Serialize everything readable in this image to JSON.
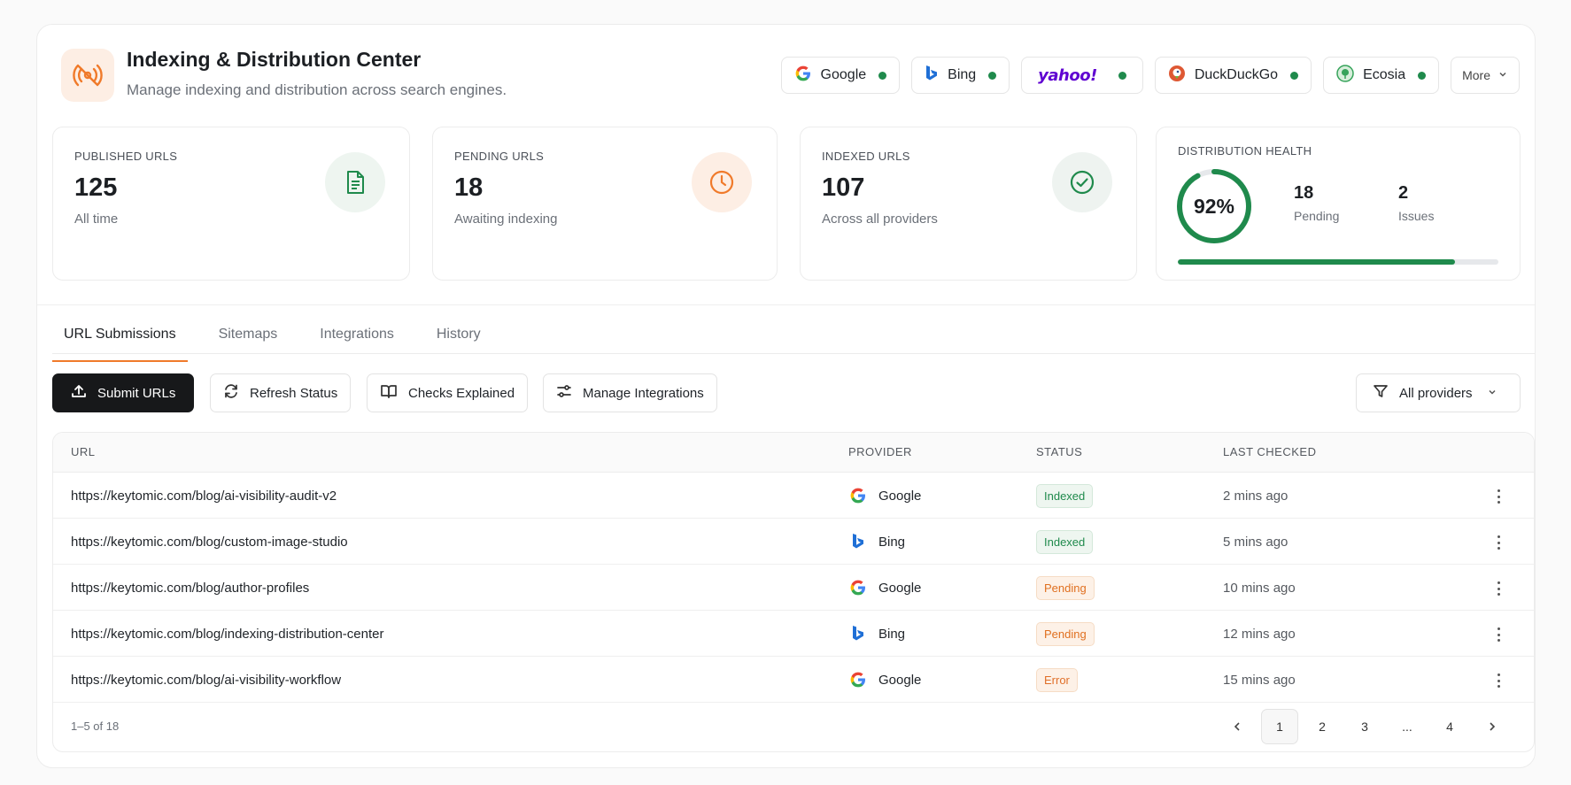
{
  "header": {
    "title": "Indexing & Distribution Center",
    "subtitle": "Manage indexing and distribution across search engines."
  },
  "providers": [
    {
      "name": "Google",
      "icon": "google-icon",
      "status": "connected"
    },
    {
      "name": "Bing",
      "icon": "bing-icon",
      "status": "connected"
    },
    {
      "name": "yahoo!",
      "icon": "yahoo-logo",
      "status": "connected"
    },
    {
      "name": "DuckDuckGo",
      "icon": "duckduckgo-icon",
      "status": "connected"
    },
    {
      "name": "Ecosia",
      "icon": "ecosia-icon",
      "status": "connected"
    }
  ],
  "more_label": "More",
  "stats": {
    "published": {
      "label": "PUBLISHED URLS",
      "value": "125",
      "sub": "All time",
      "icon": "document-icon"
    },
    "pending": {
      "label": "PENDING URLS",
      "value": "18",
      "sub": "Awaiting indexing",
      "icon": "clock-icon"
    },
    "indexed": {
      "label": "INDEXED URLS",
      "value": "107",
      "sub": "Across all providers",
      "icon": "check-circle-icon"
    }
  },
  "health": {
    "label": "DISTRIBUTION HEALTH",
    "percent_text": "92%",
    "percent": 92,
    "bar_fraction": 0.865,
    "pending_value": "18",
    "pending_label": "Pending",
    "issues_value": "2",
    "issues_label": "Issues"
  },
  "tabs": [
    "URL Submissions",
    "Sitemaps",
    "Integrations",
    "History"
  ],
  "toolbar": {
    "submit": "Submit URLs",
    "refresh": "Refresh Status",
    "checks": "Checks Explained",
    "manage": "Manage Integrations",
    "filter": "All providers"
  },
  "table": {
    "headers": {
      "url": "URL",
      "provider": "PROVIDER",
      "status": "STATUS",
      "checked": "LAST CHECKED"
    },
    "rows": [
      {
        "url": "https://keytomic.com/blog/ai-visibility-audit-v2",
        "provider": "Google",
        "status": "Indexed",
        "checked": "2 mins ago"
      },
      {
        "url": "https://keytomic.com/blog/custom-image-studio",
        "provider": "Bing",
        "status": "Indexed",
        "checked": "5 mins ago"
      },
      {
        "url": "https://keytomic.com/blog/author-profiles",
        "provider": "Google",
        "status": "Pending",
        "checked": "10 mins ago"
      },
      {
        "url": "https://keytomic.com/blog/indexing-distribution-center",
        "provider": "Bing",
        "status": "Pending",
        "checked": "12 mins ago"
      },
      {
        "url": "https://keytomic.com/blog/ai-visibility-workflow",
        "provider": "Google",
        "status": "Error",
        "checked": "15 mins ago"
      }
    ],
    "range": "1–5 of 18",
    "pages": [
      "1",
      "2",
      "3",
      "...",
      "4"
    ],
    "current_page": "1"
  },
  "colors": {
    "accent": "#f07a2a",
    "success": "#1f8a4c",
    "primary_button": "#17181a"
  }
}
